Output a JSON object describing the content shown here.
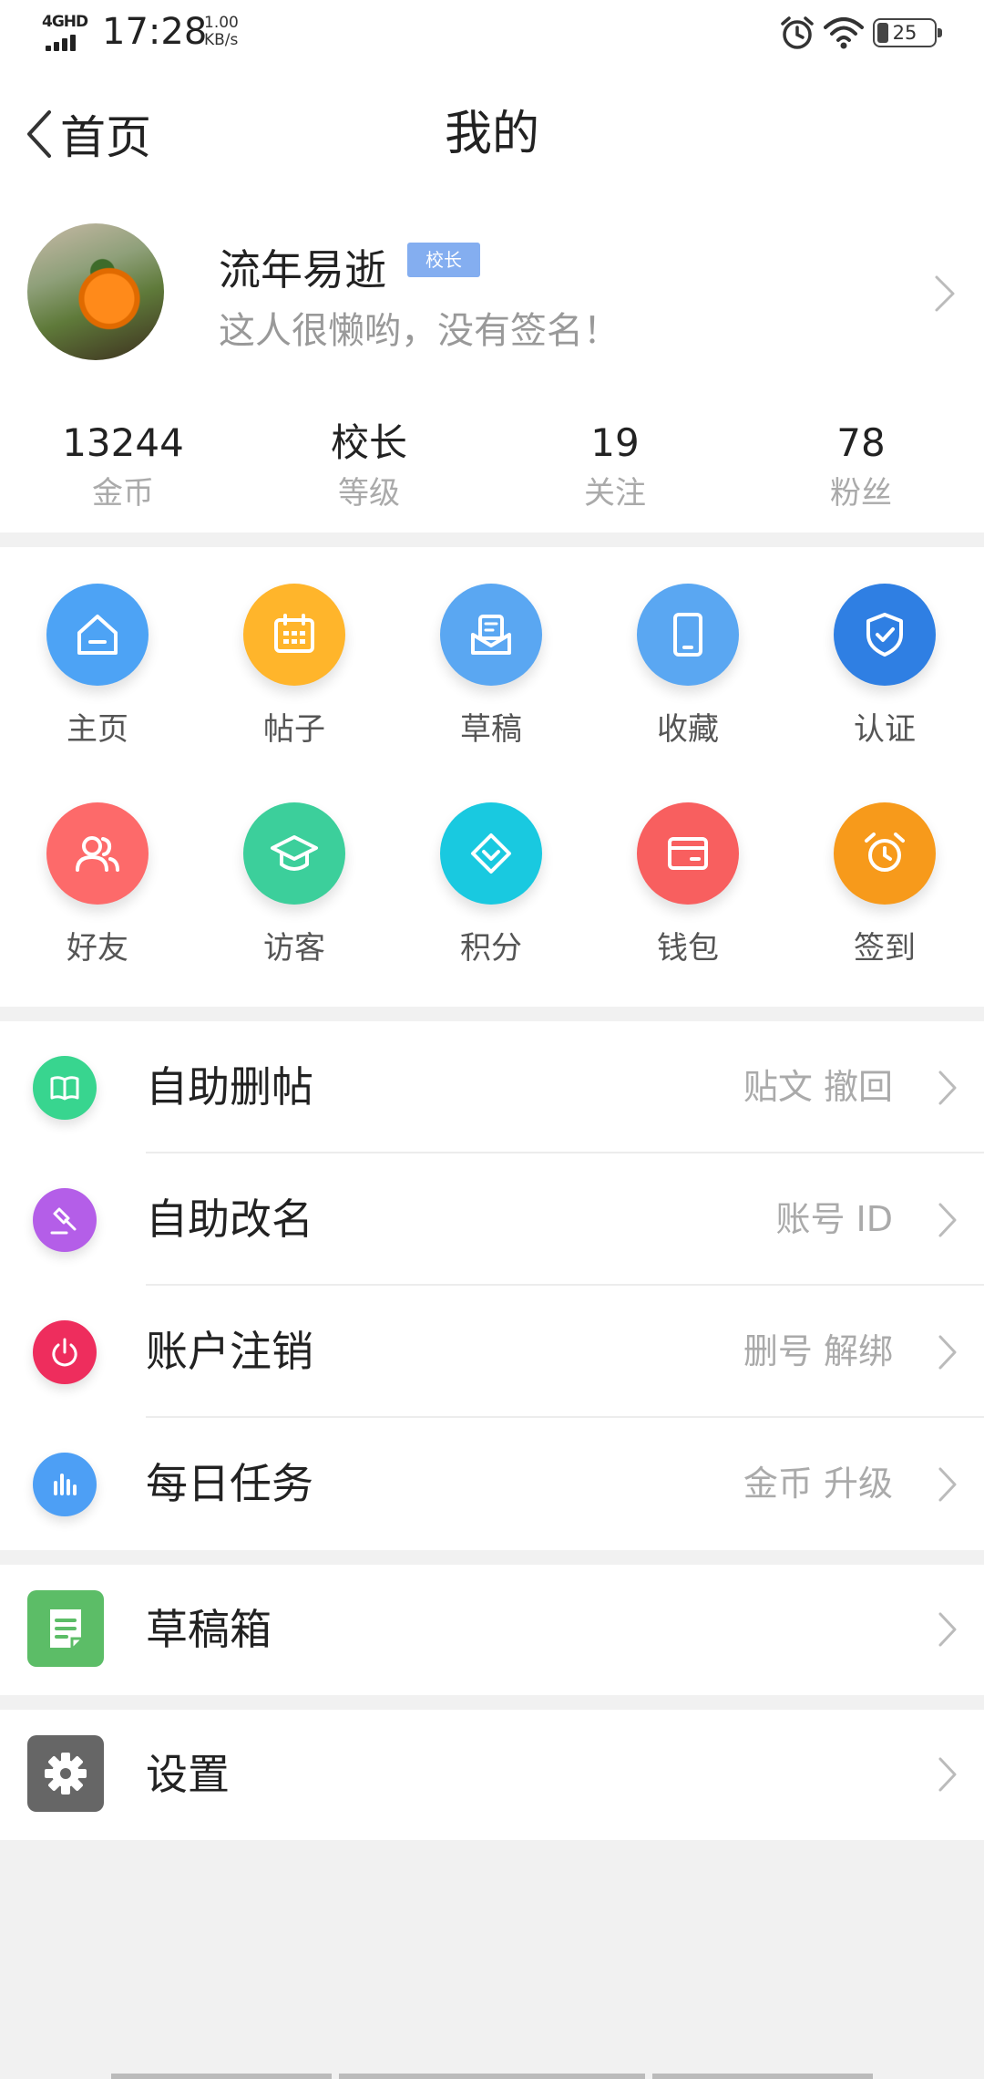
{
  "status_bar": {
    "network": "4GHD",
    "time": "17:28",
    "speed_value": "1.00",
    "speed_unit": "KB/s",
    "battery": "25"
  },
  "header": {
    "back_label": "首页",
    "title": "我的"
  },
  "profile": {
    "username": "流年易逝",
    "rank_badge": "校长",
    "signature": "这人很懒哟，没有签名！"
  },
  "stats": [
    {
      "value": "13244",
      "label": "金币"
    },
    {
      "value": "校长",
      "label": "等级"
    },
    {
      "value": "19",
      "label": "关注"
    },
    {
      "value": "78",
      "label": "粉丝"
    }
  ],
  "grid": [
    {
      "label": "主页",
      "icon": "home-icon",
      "color": "#4da3f5"
    },
    {
      "label": "帖子",
      "icon": "calendar-icon",
      "color": "#ffb52b"
    },
    {
      "label": "草稿",
      "icon": "draft-icon",
      "color": "#5aa7f2"
    },
    {
      "label": "收藏",
      "icon": "tablet-icon",
      "color": "#5aa7f2"
    },
    {
      "label": "认证",
      "icon": "shield-icon",
      "color": "#2f7fe3"
    },
    {
      "label": "好友",
      "icon": "friends-icon",
      "color": "#fd6a6a"
    },
    {
      "label": "访客",
      "icon": "graduation-cap-icon",
      "color": "#3ccf9b"
    },
    {
      "label": "积分",
      "icon": "diamond-icon",
      "color": "#19c9e0"
    },
    {
      "label": "钱包",
      "icon": "wallet-icon",
      "color": "#f85f5f"
    },
    {
      "label": "签到",
      "icon": "alarm-clock-icon",
      "color": "#f79a1b"
    }
  ],
  "list": [
    {
      "title": "自助删帖",
      "right": "贴文  撤回",
      "icon": "book-icon",
      "color": "#38d58f"
    },
    {
      "title": "自助改名",
      "right": "账号  ID",
      "icon": "gavel-icon",
      "color": "#b45ee8"
    },
    {
      "title": "账户注销",
      "right": "删号  解绑",
      "icon": "power-icon",
      "color": "#ee2d5d"
    },
    {
      "title": "每日任务",
      "right": "金币  升级",
      "icon": "bar-chart-icon",
      "color": "#4d9ff5"
    }
  ],
  "drafts": {
    "title": "草稿箱",
    "icon": "note-icon",
    "color": "#5cbd67"
  },
  "settings": {
    "title": "设置",
    "icon": "gear-icon",
    "color": "#666666"
  }
}
